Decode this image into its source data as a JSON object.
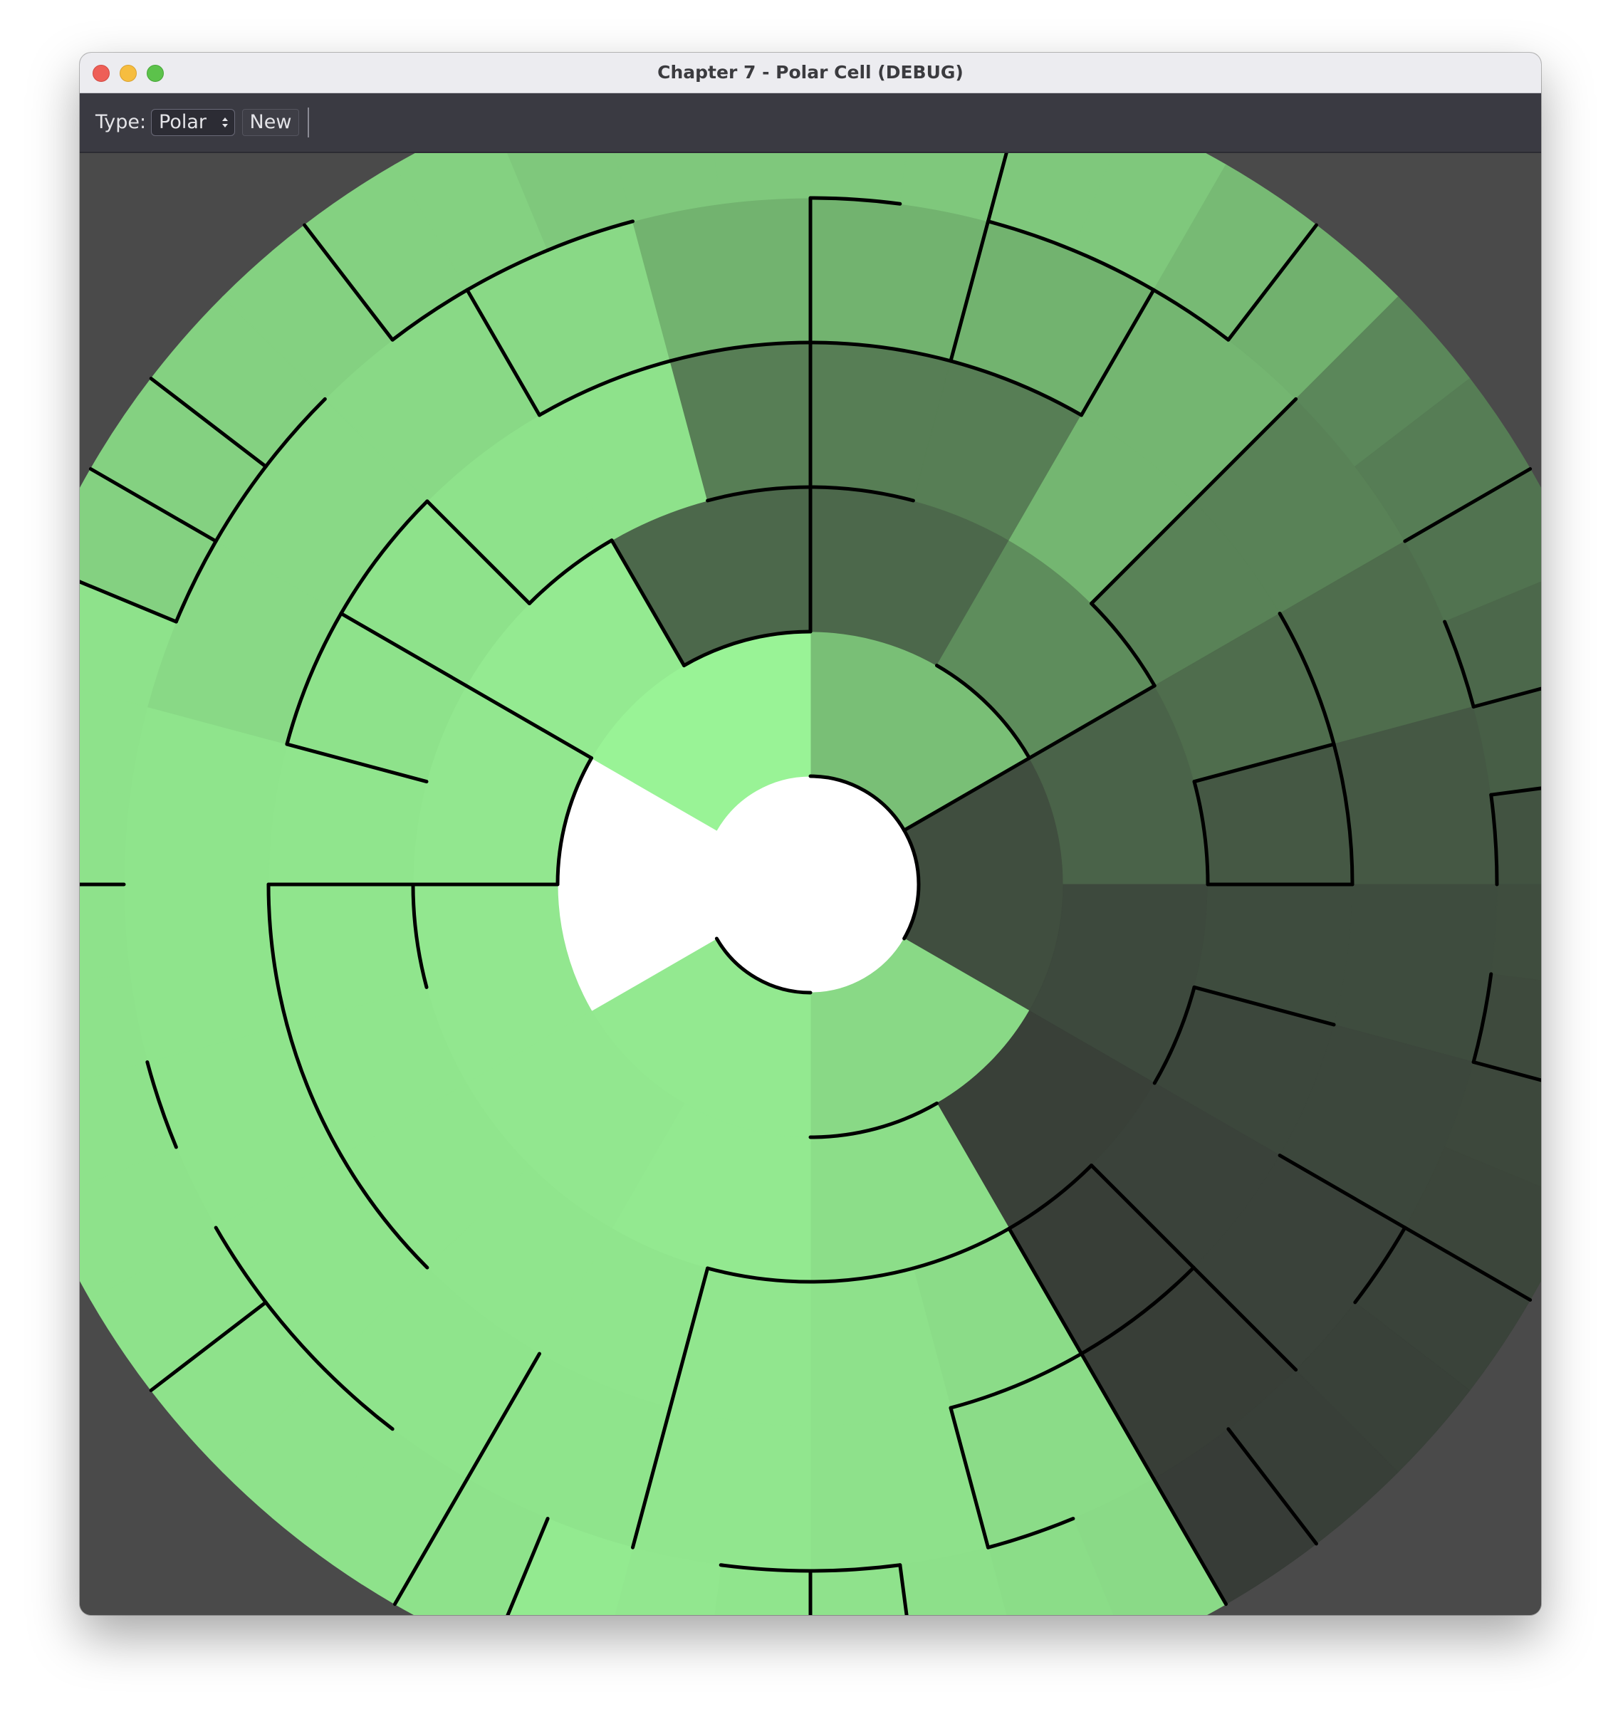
{
  "window": {
    "title": "Chapter 7 - Polar Cell (DEBUG)"
  },
  "toolbar": {
    "type_label": "Type:",
    "type_select_value": "Polar",
    "new_label": "New"
  },
  "icons": {
    "close": "traffic-close-icon",
    "minimize": "traffic-minimize-icon",
    "maximize": "traffic-maximize-icon",
    "select_arrows": "updown-chevron-icon"
  },
  "maze": {
    "grid_type": "polar",
    "rows": 5,
    "colors": {
      "background": "#4a4a4a",
      "wall": "#000000",
      "center": "#ffffff",
      "brightest_region": "#9dfa9a",
      "darkest_region": "#323232"
    }
  }
}
